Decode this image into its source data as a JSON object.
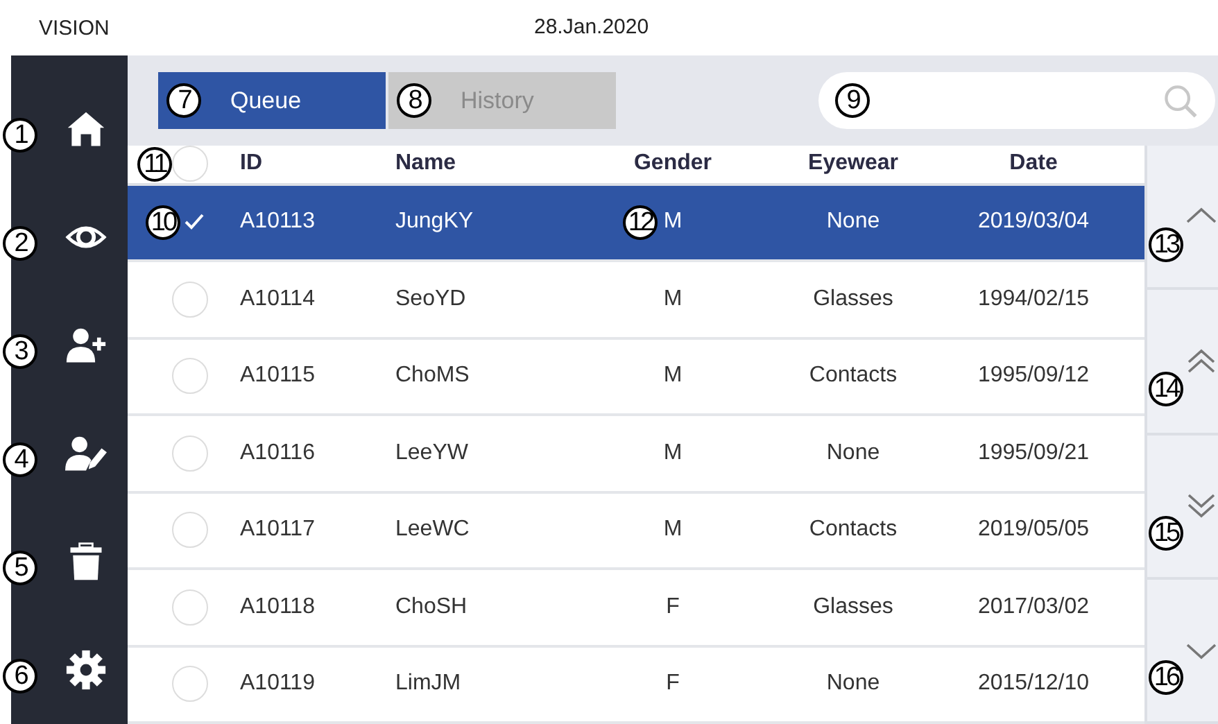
{
  "header": {
    "app_name": "VISION",
    "date": "28.Jan.2020"
  },
  "sidebar": {
    "items": [
      {
        "kind": "home",
        "callout": "1"
      },
      {
        "kind": "eye",
        "callout": "2"
      },
      {
        "kind": "person-add",
        "callout": "3"
      },
      {
        "kind": "person-edit",
        "callout": "4"
      },
      {
        "kind": "trash",
        "callout": "5"
      },
      {
        "kind": "gear",
        "callout": "6"
      }
    ]
  },
  "tabs": [
    {
      "label": "Queue",
      "selected": true,
      "callout": "7"
    },
    {
      "label": "History",
      "selected": false,
      "callout": "8"
    }
  ],
  "search": {
    "callout": "9"
  },
  "table": {
    "columns": [
      "ID",
      "Name",
      "Gender",
      "Eyewear",
      "Date"
    ],
    "header_callout": "11",
    "header_checked": false,
    "rows": [
      {
        "selected": true,
        "checked": true,
        "cells": [
          "A10113",
          "JungKY",
          "M",
          "None",
          "2019/03/04"
        ],
        "check_callout": "10",
        "gender_callout": "12"
      },
      {
        "selected": false,
        "checked": false,
        "cells": [
          "A10114",
          "SeoYD",
          "M",
          "Glasses",
          "1994/02/15"
        ]
      },
      {
        "selected": false,
        "checked": false,
        "cells": [
          "A10115",
          "ChoMS",
          "M",
          "Contacts",
          "1995/09/12"
        ]
      },
      {
        "selected": false,
        "checked": false,
        "cells": [
          "A10116",
          "LeeYW",
          "M",
          "None",
          "1995/09/21"
        ]
      },
      {
        "selected": false,
        "checked": false,
        "cells": [
          "A10117",
          "LeeWC",
          "M",
          "Contacts",
          "2019/05/05"
        ]
      },
      {
        "selected": false,
        "checked": false,
        "cells": [
          "A10118",
          "ChoSH",
          "F",
          "Glasses",
          "2017/03/02"
        ]
      },
      {
        "selected": false,
        "checked": false,
        "cells": [
          "A10119",
          "LimJM",
          "F",
          "None",
          "2015/12/10"
        ]
      }
    ]
  },
  "scroll_buttons": [
    {
      "kind": "up",
      "callout": "13"
    },
    {
      "kind": "page-up",
      "callout": "14"
    },
    {
      "kind": "page-down",
      "callout": "15"
    },
    {
      "kind": "down",
      "callout": "16"
    }
  ]
}
